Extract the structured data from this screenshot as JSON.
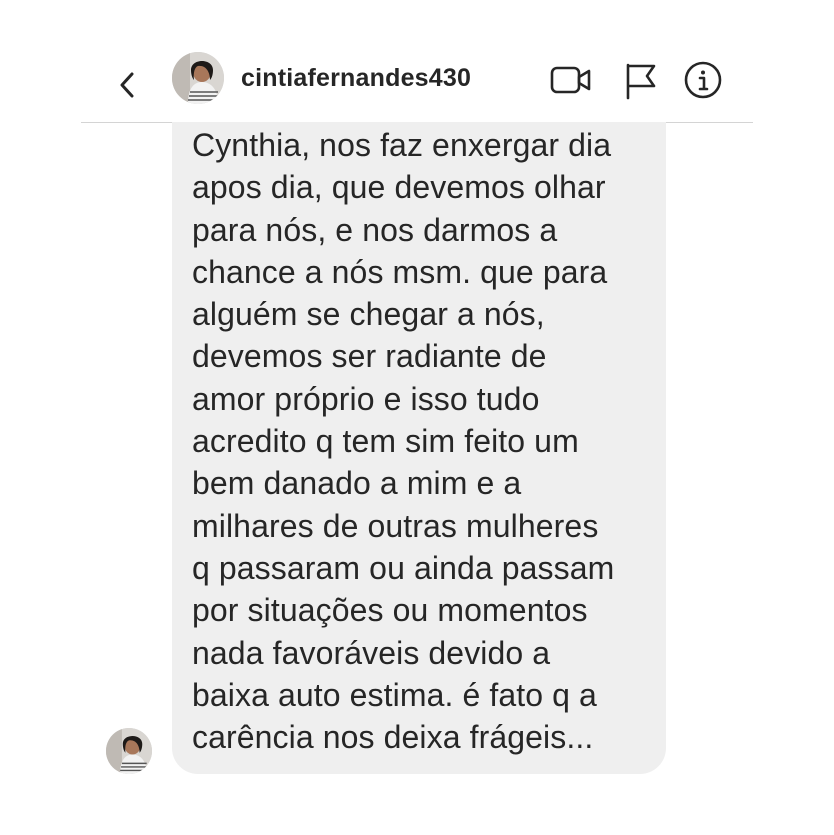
{
  "header": {
    "username": "cintiafernandes430",
    "icons": {
      "back": "chevron-left-icon",
      "video": "video-camera-icon",
      "flag": "flag-icon",
      "info": "info-icon"
    }
  },
  "message": {
    "text": "Cynthia, nos faz enxergar dia\napos dia, que devemos olhar\npara nós, e nos darmos a\nchance a nós msm. que para\nalguém se chegar a nós,\ndevemos ser radiante de\namor próprio e isso tudo\nacredito q tem sim feito um\nbem danado a mim e a\nmilhares de outras mulheres\nq passaram ou ainda passam\npor situações ou momentos\nnada favoráveis devido a\nbaixa auto estima. é fato q a\ncarência nos deixa frágeis..."
  },
  "colors": {
    "bubble_background": "#efefef",
    "text": "#262626",
    "divider": "#d4d4d4"
  }
}
